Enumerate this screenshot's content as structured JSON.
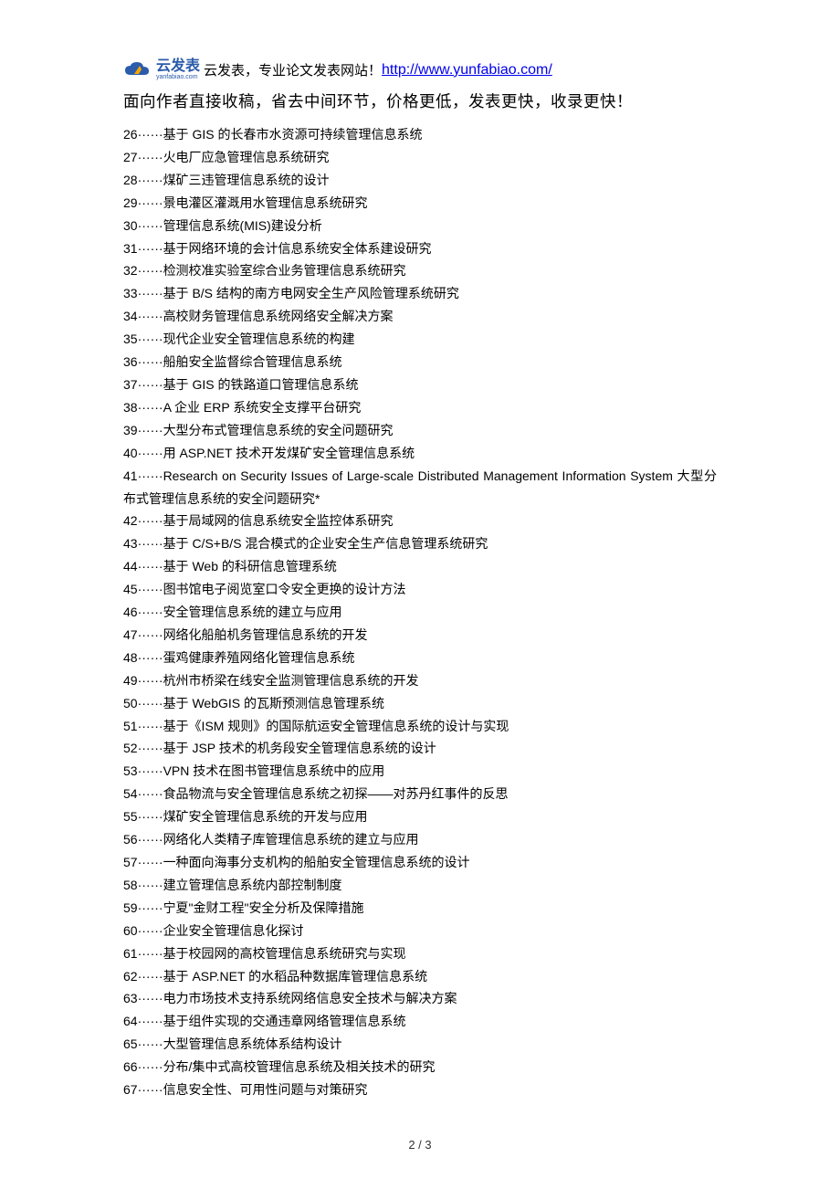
{
  "header": {
    "brand_cn": "云发表",
    "brand_en": "yanfabiao.com",
    "slogan": " 云发表，专业论文发表网站！",
    "link_text": "http://www.yunfabiao.com/"
  },
  "subtitle": "面向作者直接收稿，省去中间环节，价格更低，发表更快，收录更快！",
  "items": [
    {
      "n": "26",
      "sep": "······",
      "t": "基于 GIS 的长春市水资源可持续管理信息系统"
    },
    {
      "n": "27",
      "sep": "······",
      "t": "火电厂应急管理信息系统研究"
    },
    {
      "n": "28",
      "sep": "······",
      "t": "煤矿三违管理信息系统的设计"
    },
    {
      "n": "29",
      "sep": "······",
      "t": "景电灌区灌溉用水管理信息系统研究"
    },
    {
      "n": "30",
      "sep": "······",
      "t": "管理信息系统(MIS)建设分析"
    },
    {
      "n": "31",
      "sep": "······",
      "t": "基于网络环境的会计信息系统安全体系建设研究"
    },
    {
      "n": "32",
      "sep": "······",
      "t": "检测校准实验室综合业务管理信息系统研究"
    },
    {
      "n": "33",
      "sep": "······",
      "t": "基于 B/S 结构的南方电网安全生产风险管理系统研究"
    },
    {
      "n": "34",
      "sep": "······",
      "t": "高校财务管理信息系统网络安全解决方案"
    },
    {
      "n": "35",
      "sep": "······",
      "t": "现代企业安全管理信息系统的构建"
    },
    {
      "n": "36",
      "sep": "······",
      "t": "船舶安全监督综合管理信息系统"
    },
    {
      "n": "37",
      "sep": "······",
      "t": "基于 GIS 的铁路道口管理信息系统"
    },
    {
      "n": "38",
      "sep": "······",
      "t": "A 企业 ERP 系统安全支撑平台研究"
    },
    {
      "n": "39",
      "sep": "······",
      "t": "大型分布式管理信息系统的安全问题研究"
    },
    {
      "n": "40",
      "sep": "······",
      "t": "用 ASP.NET 技术开发煤矿安全管理信息系统"
    },
    {
      "n": "41",
      "sep": "······",
      "t": "Research on Security Issues of Large-scale Distributed Management Information System 大型分布式管理信息系统的安全问题研究*"
    },
    {
      "n": "42",
      "sep": "······",
      "t": "基于局域网的信息系统安全监控体系研究"
    },
    {
      "n": "43",
      "sep": "······",
      "t": "基于 C/S+B/S 混合模式的企业安全生产信息管理系统研究"
    },
    {
      "n": "44",
      "sep": "······",
      "t": "基于 Web 的科研信息管理系统"
    },
    {
      "n": "45",
      "sep": "······",
      "t": "图书馆电子阅览室口令安全更换的设计方法"
    },
    {
      "n": "46",
      "sep": "······",
      "t": "安全管理信息系统的建立与应用"
    },
    {
      "n": "47",
      "sep": "······",
      "t": "网络化船舶机务管理信息系统的开发"
    },
    {
      "n": "48",
      "sep": "······",
      "t": "蛋鸡健康养殖网络化管理信息系统"
    },
    {
      "n": "49",
      "sep": "······",
      "t": "杭州市桥梁在线安全监测管理信息系统的开发"
    },
    {
      "n": "50",
      "sep": "······",
      "t": "基于 WebGIS 的瓦斯预测信息管理系统"
    },
    {
      "n": "51",
      "sep": "······",
      "t": "基于《ISM 规则》的国际航运安全管理信息系统的设计与实现"
    },
    {
      "n": "52",
      "sep": "······",
      "t": "基于 JSP 技术的机务段安全管理信息系统的设计"
    },
    {
      "n": "53",
      "sep": "······",
      "t": "VPN 技术在图书管理信息系统中的应用"
    },
    {
      "n": "54",
      "sep": "······",
      "t": "食品物流与安全管理信息系统之初探——对苏丹红事件的反思"
    },
    {
      "n": "55",
      "sep": "······",
      "t": "煤矿安全管理信息系统的开发与应用"
    },
    {
      "n": "56",
      "sep": "······",
      "t": "网络化人类精子库管理信息系统的建立与应用"
    },
    {
      "n": "57",
      "sep": "······",
      "t": "一种面向海事分支机构的船舶安全管理信息系统的设计"
    },
    {
      "n": "58",
      "sep": "······",
      "t": "建立管理信息系统内部控制制度"
    },
    {
      "n": "59",
      "sep": "······",
      "t": "宁夏\"金财工程\"安全分析及保障措施"
    },
    {
      "n": "60",
      "sep": "······",
      "t": "企业安全管理信息化探讨"
    },
    {
      "n": "61",
      "sep": "······",
      "t": "基于校园网的高校管理信息系统研究与实现"
    },
    {
      "n": "62",
      "sep": "······",
      "t": "基于 ASP.NET 的水稻品种数据库管理信息系统"
    },
    {
      "n": "63",
      "sep": "······",
      "t": "电力市场技术支持系统网络信息安全技术与解决方案"
    },
    {
      "n": "64",
      "sep": "······",
      "t": "基于组件实现的交通违章网络管理信息系统"
    },
    {
      "n": "65",
      "sep": "······",
      "t": "大型管理信息系统体系结构设计"
    },
    {
      "n": "66",
      "sep": "······",
      "t": "分布/集中式高校管理信息系统及相关技术的研究"
    },
    {
      "n": "67",
      "sep": "······",
      "t": "信息安全性、可用性问题与对策研究"
    }
  ],
  "page_number": "2 / 3"
}
